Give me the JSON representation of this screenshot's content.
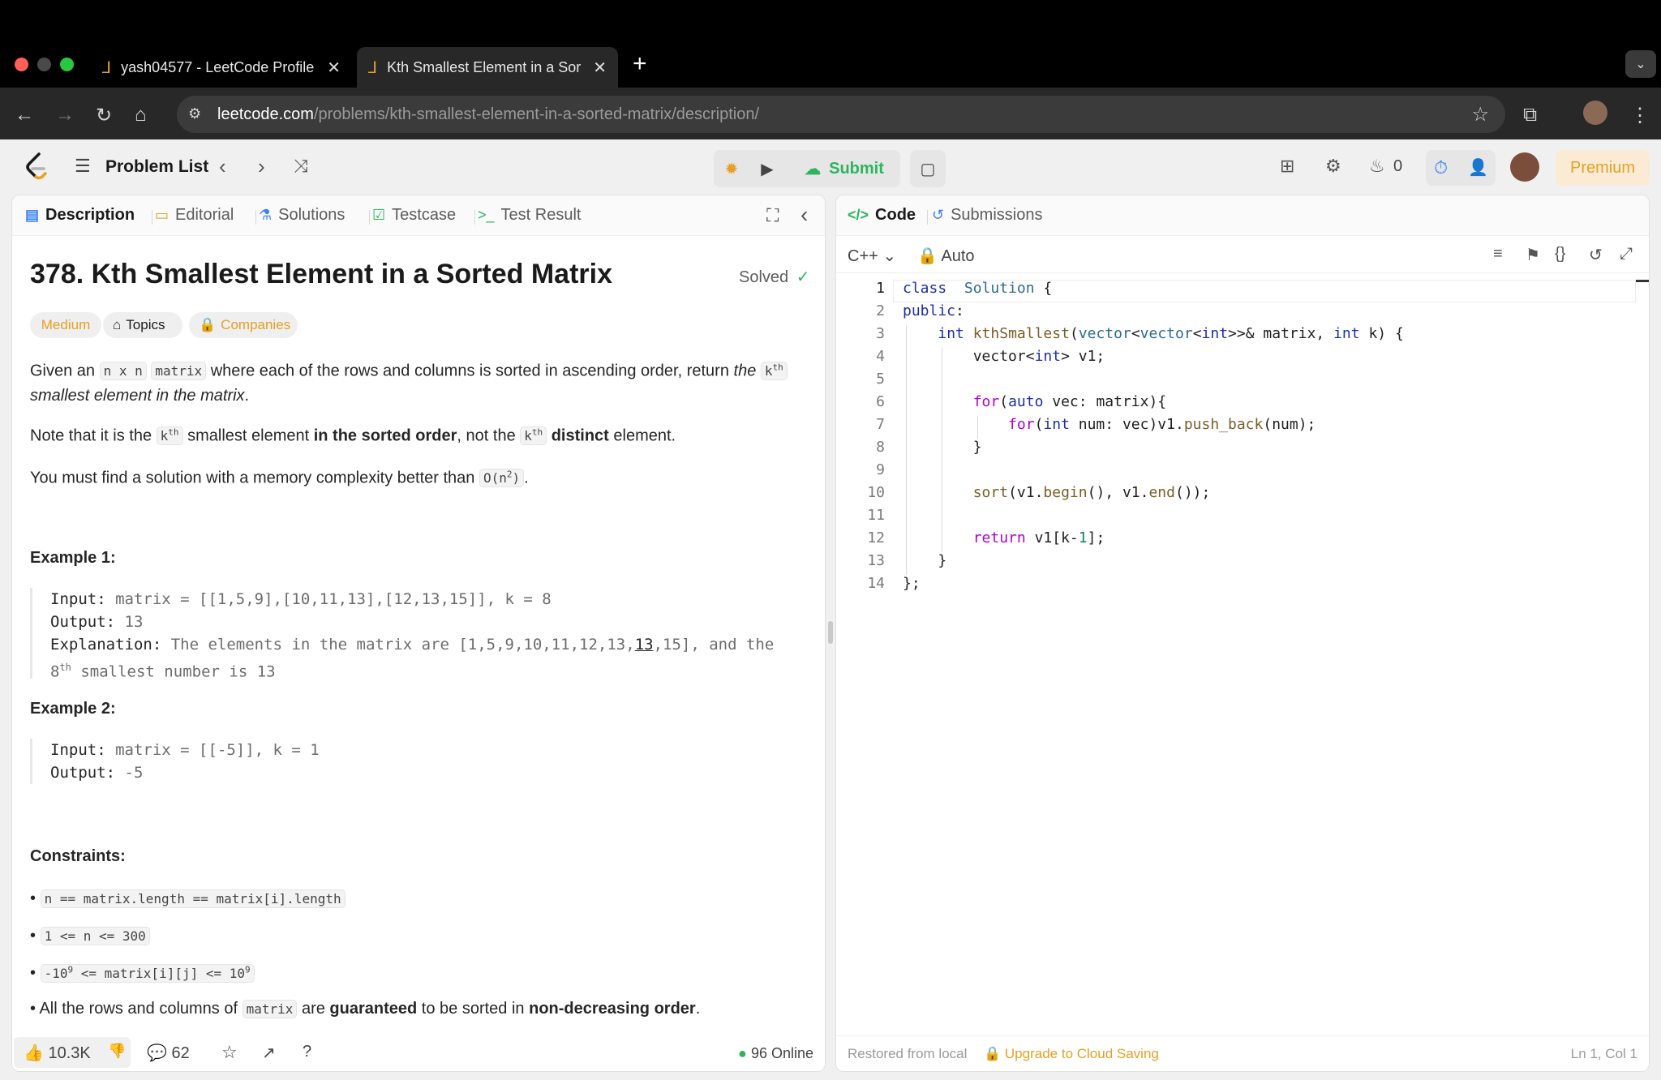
{
  "browser": {
    "tabs": [
      {
        "title": "yash04577 - LeetCode Profile",
        "active": false
      },
      {
        "title": "Kth Smallest Element in a Sor",
        "active": true
      }
    ],
    "url_host": "leetcode.com",
    "url_path": "/problems/kth-smallest-element-in-a-sorted-matrix/description/"
  },
  "app": {
    "problem_list_label": "Problem List",
    "submit_label": "Submit",
    "streak_count": "0",
    "premium_label": "Premium"
  },
  "left": {
    "tabs": [
      "Description",
      "Editorial",
      "Solutions",
      "Testcase",
      "Test Result"
    ],
    "title": "378. Kth Smallest Element in a Sorted Matrix",
    "solved_label": "Solved",
    "tags": {
      "difficulty": "Medium",
      "topics": "Topics",
      "companies": "Companies"
    },
    "p1": {
      "a": "Given an",
      "code1": "n x n",
      "code2": "matrix",
      "b": "where each of the rows and columns is sorted in ascending order, return",
      "c": "the",
      "kth": "k",
      "sup": "th",
      "d": "smallest element in the matrix",
      "e": "."
    },
    "p2": {
      "a": "Note that it is the",
      "b": "smallest element",
      "c": "in the sorted order",
      "d": ", not the",
      "e": "distinct",
      "f": "element."
    },
    "p3": {
      "a": "You must find a solution with a memory complexity better than",
      "code": "O(n",
      "code_sup": "2",
      "code_end": ")",
      "end": "."
    },
    "example1": {
      "heading": "Example 1:",
      "input_label": "Input:",
      "input": "matrix = [[1,5,9],[10,11,13],[12,13,15]], k = 8",
      "output_label": "Output:",
      "output": "13",
      "explanation_label": "Explanation:",
      "explanation_a": "The elements in the matrix are [1,5,9,10,11,12,13,",
      "explanation_u": "13",
      "explanation_b": ",15], and the",
      "explanation_c1": "8",
      "explanation_c_sup": "th",
      "explanation_c2": "smallest number is 13"
    },
    "example2": {
      "heading": "Example 2:",
      "input_label": "Input:",
      "input": "matrix = [[-5]], k = 1",
      "output_label": "Output:",
      "output": "-5"
    },
    "constraints": {
      "heading": "Constraints:",
      "c1": "n == matrix.length == matrix[i].length",
      "c2": "1 <= n <= 300",
      "c3a": "-10",
      "c3sup1": "9",
      "c3b": "<= matrix[i][j] <= 10",
      "c3sup2": "9",
      "c4a": "All the rows and columns of",
      "c4code": "matrix",
      "c4b": "are",
      "c4c": "guaranteed",
      "c4d": "to be sorted in",
      "c4e": "non-decreasing order",
      "c4f": "."
    },
    "footer": {
      "likes": "10.3K",
      "comments": "62",
      "online": "96 Online"
    }
  },
  "right": {
    "tabs": [
      "Code",
      "Submissions"
    ],
    "language": "C++",
    "mode": "Auto",
    "code": [
      [
        [
          "kw",
          "class"
        ],
        [
          "",
          "  "
        ],
        [
          "ty",
          "Solution"
        ],
        [
          "",
          " {"
        ]
      ],
      [
        [
          "kw",
          "public"
        ],
        [
          "",
          ":"
        ]
      ],
      [
        [
          "",
          "    "
        ],
        [
          "kw",
          "int"
        ],
        [
          "",
          " "
        ],
        [
          "fn",
          "kthSmallest"
        ],
        [
          "",
          "("
        ],
        [
          "ty",
          "vector"
        ],
        [
          "",
          "<"
        ],
        [
          "ty",
          "vector"
        ],
        [
          "",
          "<"
        ],
        [
          "kw",
          "int"
        ],
        [
          "",
          ">>& matrix, "
        ],
        [
          "kw",
          "int"
        ],
        [
          "",
          " k) {"
        ]
      ],
      [
        [
          "",
          "        vector<"
        ],
        [
          "kw",
          "int"
        ],
        [
          "",
          "> v1;"
        ]
      ],
      [],
      [
        [
          "",
          "        "
        ],
        [
          "ctl",
          "for"
        ],
        [
          "",
          "("
        ],
        [
          "kw",
          "auto"
        ],
        [
          "",
          " vec: matrix){"
        ]
      ],
      [
        [
          "",
          "            "
        ],
        [
          "ctl",
          "for"
        ],
        [
          "",
          "("
        ],
        [
          "kw",
          "int"
        ],
        [
          "",
          " num: vec)v1."
        ],
        [
          "fn",
          "push_back"
        ],
        [
          "",
          "(num);"
        ]
      ],
      [
        [
          "",
          "        }"
        ]
      ],
      [],
      [
        [
          "",
          "        "
        ],
        [
          "fn",
          "sort"
        ],
        [
          "",
          "(v1."
        ],
        [
          "fn",
          "begin"
        ],
        [
          "",
          "(), v1."
        ],
        [
          "fn",
          "end"
        ],
        [
          "",
          "());"
        ]
      ],
      [],
      [
        [
          "",
          "        "
        ],
        [
          "ctl",
          "return"
        ],
        [
          "",
          " v1[k-"
        ],
        [
          "num",
          "1"
        ],
        [
          "",
          "];"
        ]
      ],
      [
        [
          "",
          "    }"
        ]
      ],
      [
        [
          "",
          "};"
        ]
      ]
    ],
    "footer": {
      "restored": "Restored from local",
      "upgrade": "Upgrade to Cloud Saving",
      "cursor": "Ln 1, Col 1"
    }
  },
  "colors": {
    "accent_green": "#2db55d",
    "medium_yellow": "#e79f24",
    "premium_bg": "#fbebd5"
  }
}
